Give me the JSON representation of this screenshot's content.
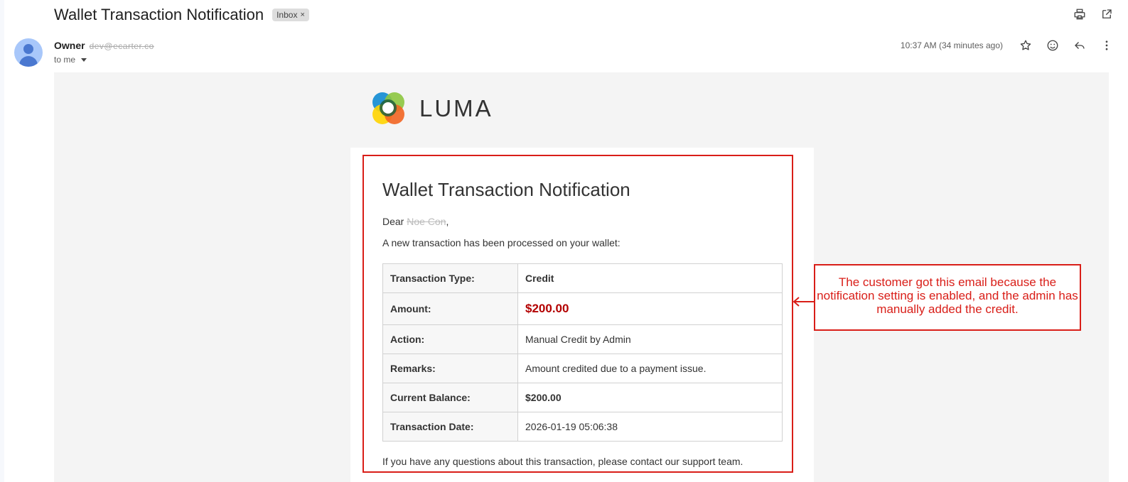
{
  "header": {
    "subject": "Wallet Transaction Notification",
    "label_chip": "Inbox",
    "label_close": "×"
  },
  "sender": {
    "name": "Owner",
    "email": "dev@ecarter.co",
    "to_label": "to me",
    "timestamp": "10:37 AM (34 minutes ago)"
  },
  "icons": {
    "print": "print-icon",
    "open_new": "open-in-new-icon",
    "star": "star-icon",
    "emoji": "emoji-icon",
    "reply": "reply-icon",
    "more": "more-vert-icon"
  },
  "brand": {
    "logo_text": "LUMA",
    "colors": [
      "#1a8fd4",
      "#8dc63f",
      "#f7941e",
      "#ef4136",
      "#ffd400",
      "#1e5f8c"
    ]
  },
  "message": {
    "title": "Wallet Transaction Notification",
    "greeting_prefix": "Dear",
    "customer_name": "Noe Con",
    "greeting_suffix": ",",
    "intro": "A new transaction has been processed on your wallet:",
    "rows": [
      {
        "label": "Transaction Type:",
        "value": "Credit"
      },
      {
        "label": "Amount:",
        "value": "$200.00"
      },
      {
        "label": "Action:",
        "value": "Manual Credit by Admin"
      },
      {
        "label": "Remarks:",
        "value": "Amount credited due to a payment issue."
      },
      {
        "label": "Current Balance:",
        "value": "$200.00"
      },
      {
        "label": "Transaction Date:",
        "value": "2026-01-19 05:06:38"
      }
    ],
    "footer": "If you have any questions about this transaction, please contact our support team."
  },
  "annotation": {
    "text": "The customer got this email because the notification setting is enabled, and the admin has manually added the credit.",
    "color": "#d91e18"
  }
}
